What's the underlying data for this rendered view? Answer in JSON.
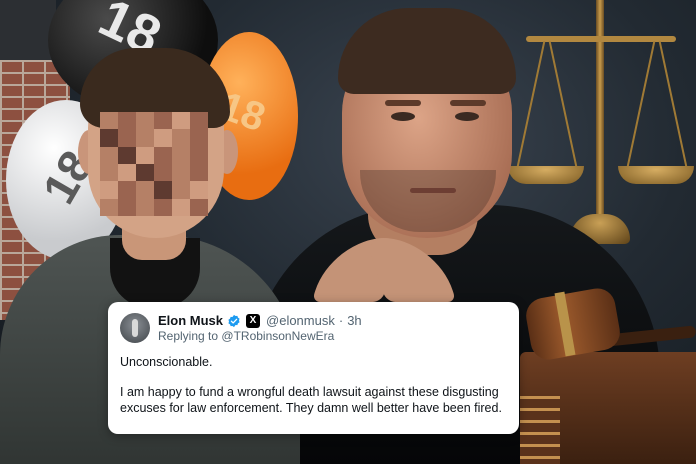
{
  "tweet": {
    "display_name": "Elon Musk",
    "verified_icon": "verified-check-icon",
    "platform_icon": "x-logo-icon",
    "platform_glyph": "X",
    "handle": "@elonmusk",
    "separator": "·",
    "time": "3h",
    "reply_prefix": "Replying to",
    "reply_handle": "@TRobinsonNewEra",
    "paragraph_1": "Unconscionable.",
    "paragraph_2": "I am happy to fund a wrongful death lawsuit against these disgusting excuses for law enforcement. They damn well better have been fired."
  },
  "balloons": {
    "black_number": "18",
    "white_number": "18",
    "orange_number": "18"
  },
  "colors": {
    "verified_blue": "#1d9bf0",
    "balloon_orange": "#e86d11"
  }
}
